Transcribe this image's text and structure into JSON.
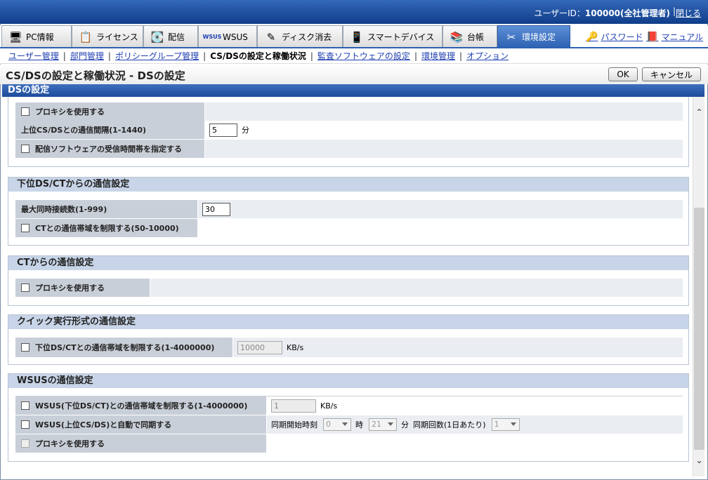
{
  "header": {
    "user_label": "ユーザーID：",
    "user_value": "100000(全社管理者)",
    "separator": "|",
    "close": "閉じる"
  },
  "tabs": [
    {
      "label": "PC情報",
      "icon": "pc-icon"
    },
    {
      "label": "ライセンス",
      "icon": "license-icon"
    },
    {
      "label": "配信",
      "icon": "distribution-icon"
    },
    {
      "label": "WSUS",
      "icon": "wsus-icon"
    },
    {
      "label": "ディスク消去",
      "icon": "disk-erase-icon"
    },
    {
      "label": "スマートデバイス",
      "icon": "smart-device-icon"
    },
    {
      "label": "台帳",
      "icon": "ledger-icon"
    },
    {
      "label": "環境設定",
      "icon": "tools-icon"
    }
  ],
  "right_links": {
    "password": "パスワード",
    "manual": "マニュアル"
  },
  "subnav": {
    "user": "ユーザー管理",
    "dept": "部門管理",
    "policy": "ポリシーグループ管理",
    "current": "CS/DSの設定と稼働状況",
    "audit": "監査ソフトウェアの設定",
    "env": "環境管理",
    "option": "オプション"
  },
  "page": {
    "title": "CS/DSの設定と稼働状況 - DSの設定",
    "ok": "OK",
    "cancel": "キャンセル",
    "section": "DSの設定"
  },
  "g1": {
    "proxy": "プロキシを使用する",
    "interval_label": "上位CS/DSとの通信間隔(1-1440)",
    "interval_value": "5",
    "interval_unit": "分",
    "recv_time": "配信ソフトウェアの受信時間帯を指定する"
  },
  "g2": {
    "title": "下位DS/CTからの通信設定",
    "max_label": "最大同時接続数(1-999)",
    "max_value": "30",
    "bw_label": "CTとの通信帯域を制限する(50-10000)"
  },
  "g3": {
    "title": "CTからの通信設定",
    "proxy": "プロキシを使用する"
  },
  "g4": {
    "title": "クイック実行形式の通信設定",
    "bw_label": "下位DS/CTとの通信帯域を制限する(1-4000000)",
    "bw_value": "10000",
    "bw_unit": "KB/s"
  },
  "g5": {
    "title": "WSUSの通信設定",
    "bw_label": "WSUS(下位DS/CT)との通信帯域を制限する(1-4000000)",
    "bw_value": "1",
    "bw_unit": "KB/s",
    "sync_label": "WSUS(上位CS/DS)と自動で同期する",
    "sync_start": "同期開始時刻",
    "hour_value": "0",
    "hour_unit": "時",
    "min_value": "21",
    "min_unit": "分",
    "count_label": "同期回数(1日あたり)",
    "count_value": "1",
    "proxy": "プロキシを使用する"
  },
  "colors": {
    "accent": "#2d62b3",
    "label_bg": "#c9cfd8",
    "group_header": "#c8d5e8"
  }
}
